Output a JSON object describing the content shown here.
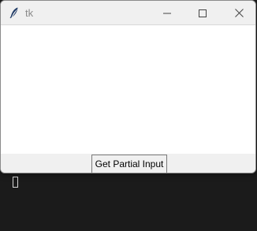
{
  "window": {
    "title": "tk",
    "app_icon": "feather-icon",
    "controls": {
      "minimize": "minimize-icon",
      "maximize": "maximize-icon",
      "close": "close-icon"
    }
  },
  "main": {
    "button_label": "Get Partial Input"
  },
  "terminal": {
    "cursor": "block-cursor"
  },
  "colors": {
    "terminal_bg": "#1b1b1b",
    "window_bg": "#f0f0f0",
    "content_bg": "#ffffff",
    "title_text": "#8a8a8a"
  }
}
